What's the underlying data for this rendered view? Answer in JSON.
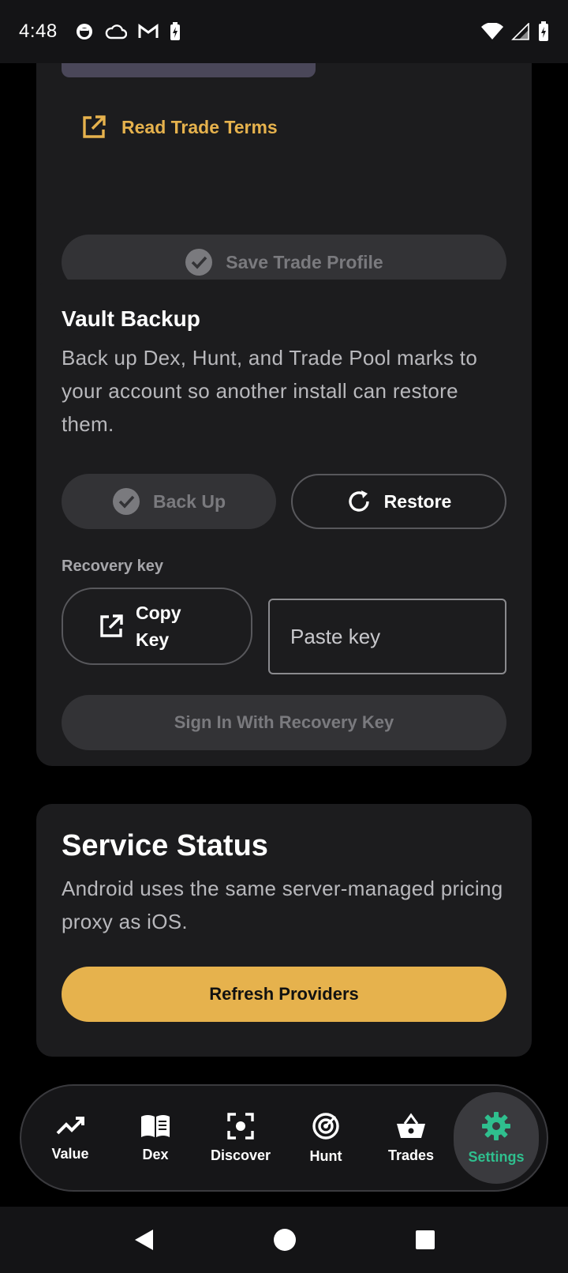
{
  "status_bar": {
    "time": "4:48"
  },
  "trade_card": {
    "read_terms_label": "Read Trade Terms",
    "save_profile_label": "Save Trade Profile"
  },
  "vault_card": {
    "title": "Vault Backup",
    "description": "Back up Dex, Hunt, and Trade Pool marks to your account so another install can restore them.",
    "backup_label": "Back Up",
    "restore_label": "Restore",
    "recovery_key_label": "Recovery key",
    "copy_key_line1": "Copy",
    "copy_key_line2": "Key",
    "paste_key_placeholder": "Paste key",
    "sign_in_label": "Sign In With Recovery Key"
  },
  "service_card": {
    "title": "Service Status",
    "description": "Android uses the same server-managed pricing proxy as iOS.",
    "refresh_label": "Refresh Providers"
  },
  "tabs": [
    {
      "label": "Value",
      "icon": "trending-icon"
    },
    {
      "label": "Dex",
      "icon": "book-icon"
    },
    {
      "label": "Discover",
      "icon": "scan-icon"
    },
    {
      "label": "Hunt",
      "icon": "radar-icon"
    },
    {
      "label": "Trades",
      "icon": "basket-icon"
    },
    {
      "label": "Settings",
      "icon": "gear-icon",
      "active": true
    }
  ],
  "colors": {
    "accent": "#e6b24d",
    "active_tab": "#2fbf8e",
    "card_bg": "#1c1c1e"
  }
}
